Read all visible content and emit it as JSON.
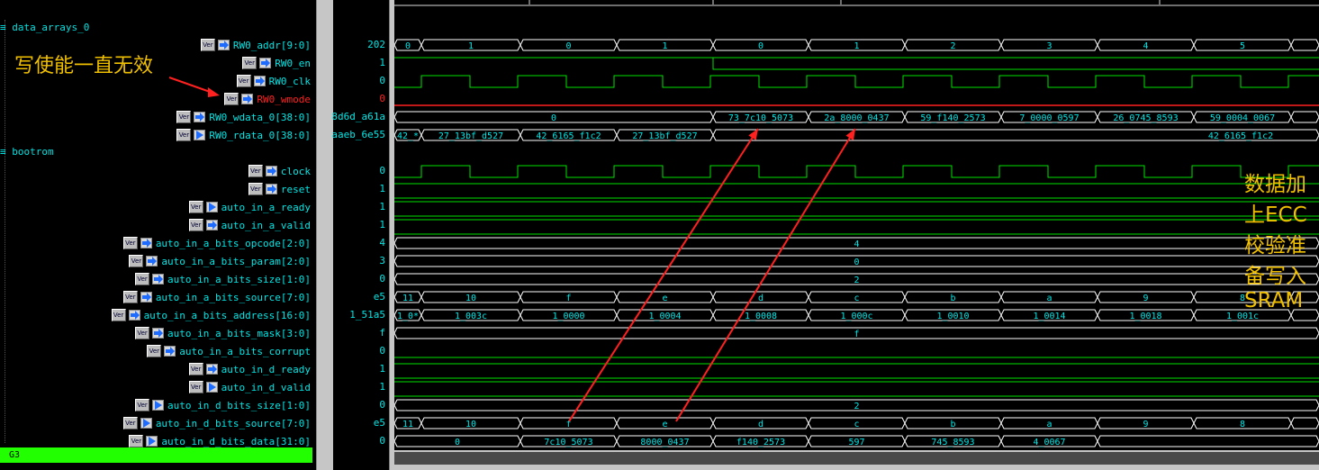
{
  "groups": [
    {
      "name": "data_arrays_0"
    },
    {
      "name": "bootrom"
    }
  ],
  "signals": [
    {
      "name": "RW0_addr[9:0]",
      "value": "202",
      "dir": "in",
      "kind": "bus",
      "cells": [
        {
          "s": 0,
          "e": 30,
          "t": "0"
        },
        {
          "s": 30,
          "e": 140,
          "t": "1"
        },
        {
          "s": 140,
          "e": 247,
          "t": "0"
        },
        {
          "s": 247,
          "e": 354,
          "t": "1"
        },
        {
          "s": 354,
          "e": 460,
          "t": "0"
        },
        {
          "s": 460,
          "e": 567,
          "t": "1"
        },
        {
          "s": 567,
          "e": 674,
          "t": "2"
        },
        {
          "s": 674,
          "e": 781,
          "t": "3"
        },
        {
          "s": 781,
          "e": 888,
          "t": "4"
        },
        {
          "s": 888,
          "e": 996,
          "t": "5"
        },
        {
          "s": 996,
          "e": 1027,
          "t": ""
        }
      ]
    },
    {
      "name": "RW0_en",
      "value": "1",
      "dir": "in",
      "kind": "en"
    },
    {
      "name": "RW0_clk",
      "value": "0",
      "dir": "in",
      "kind": "clk"
    },
    {
      "name": "RW0_wmode",
      "value": "0",
      "dir": "in",
      "kind": "low-red",
      "red": true
    },
    {
      "name": "RW0_wdata_0[38:0]",
      "value": "8d6d_a61a",
      "dir": "in",
      "kind": "bus",
      "cells": [
        {
          "s": 0,
          "e": 354,
          "t": "0"
        },
        {
          "s": 354,
          "e": 460,
          "t": "73_7c10_5073"
        },
        {
          "s": 460,
          "e": 567,
          "t": "2a_8000_0437"
        },
        {
          "s": 567,
          "e": 674,
          "t": "59_f140_2573"
        },
        {
          "s": 674,
          "e": 781,
          "t": "7_0000_0597"
        },
        {
          "s": 781,
          "e": 888,
          "t": "26_0745_8593"
        },
        {
          "s": 888,
          "e": 996,
          "t": "59_0004_0067"
        },
        {
          "s": 996,
          "e": 1027,
          "t": ""
        }
      ]
    },
    {
      "name": "RW0_rdata_0[38:0]",
      "value": "aaeb_6e55",
      "dir": "out",
      "kind": "bus",
      "cells": [
        {
          "s": 0,
          "e": 30,
          "t": "42_*"
        },
        {
          "s": 30,
          "e": 140,
          "t": "27_13bf_d527"
        },
        {
          "s": 140,
          "e": 247,
          "t": "42_6165_f1c2"
        },
        {
          "s": 247,
          "e": 354,
          "t": "27_13bf_d527"
        },
        {
          "s": 354,
          "e": 1027,
          "t": "42_6165_f1c2",
          "right": true
        }
      ]
    },
    {
      "name": "clock",
      "value": "0",
      "dir": "in",
      "kind": "clk"
    },
    {
      "name": "reset",
      "value": "1",
      "dir": "in",
      "kind": "high"
    },
    {
      "name": "auto_in_a_ready",
      "value": "1",
      "dir": "out",
      "kind": "high"
    },
    {
      "name": "auto_in_a_valid",
      "value": "1",
      "dir": "in",
      "kind": "high"
    },
    {
      "name": "auto_in_a_bits_opcode[2:0]",
      "value": "4",
      "dir": "in",
      "kind": "bus",
      "cells": [
        {
          "s": 0,
          "e": 1027,
          "t": "4"
        }
      ]
    },
    {
      "name": "auto_in_a_bits_param[2:0]",
      "value": "3",
      "dir": "in",
      "kind": "bus",
      "cells": [
        {
          "s": 0,
          "e": 1027,
          "t": "0"
        }
      ]
    },
    {
      "name": "auto_in_a_bits_size[1:0]",
      "value": "0",
      "dir": "in",
      "kind": "bus",
      "cells": [
        {
          "s": 0,
          "e": 1027,
          "t": "2"
        }
      ]
    },
    {
      "name": "auto_in_a_bits_source[7:0]",
      "value": "e5",
      "dir": "in",
      "kind": "bus",
      "cells": [
        {
          "s": 0,
          "e": 30,
          "t": "11"
        },
        {
          "s": 30,
          "e": 140,
          "t": "10"
        },
        {
          "s": 140,
          "e": 247,
          "t": "f"
        },
        {
          "s": 247,
          "e": 354,
          "t": "e"
        },
        {
          "s": 354,
          "e": 460,
          "t": "d"
        },
        {
          "s": 460,
          "e": 567,
          "t": "c"
        },
        {
          "s": 567,
          "e": 674,
          "t": "b"
        },
        {
          "s": 674,
          "e": 781,
          "t": "a"
        },
        {
          "s": 781,
          "e": 888,
          "t": "9"
        },
        {
          "s": 888,
          "e": 996,
          "t": "8"
        },
        {
          "s": 996,
          "e": 1027,
          "t": ""
        }
      ]
    },
    {
      "name": "auto_in_a_bits_address[16:0]",
      "value": "1_51a5",
      "dir": "in",
      "kind": "bus",
      "cells": [
        {
          "s": 0,
          "e": 30,
          "t": "1_0*"
        },
        {
          "s": 30,
          "e": 140,
          "t": "1_003c"
        },
        {
          "s": 140,
          "e": 247,
          "t": "1_0000"
        },
        {
          "s": 247,
          "e": 354,
          "t": "1_0004"
        },
        {
          "s": 354,
          "e": 460,
          "t": "1_0008"
        },
        {
          "s": 460,
          "e": 567,
          "t": "1_000c"
        },
        {
          "s": 567,
          "e": 674,
          "t": "1_0010"
        },
        {
          "s": 674,
          "e": 781,
          "t": "1_0014"
        },
        {
          "s": 781,
          "e": 888,
          "t": "1_0018"
        },
        {
          "s": 888,
          "e": 996,
          "t": "1_001c"
        },
        {
          "s": 996,
          "e": 1027,
          "t": ""
        }
      ]
    },
    {
      "name": "auto_in_a_bits_mask[3:0]",
      "value": "f",
      "dir": "in",
      "kind": "bus",
      "cells": [
        {
          "s": 0,
          "e": 1027,
          "t": "f"
        }
      ]
    },
    {
      "name": "auto_in_a_bits_corrupt",
      "value": "0",
      "dir": "in",
      "kind": "low"
    },
    {
      "name": "auto_in_d_ready",
      "value": "1",
      "dir": "in",
      "kind": "high"
    },
    {
      "name": "auto_in_d_valid",
      "value": "1",
      "dir": "out",
      "kind": "high"
    },
    {
      "name": "auto_in_d_bits_size[1:0]",
      "value": "0",
      "dir": "out",
      "kind": "bus",
      "cells": [
        {
          "s": 0,
          "e": 1027,
          "t": "2"
        }
      ]
    },
    {
      "name": "auto_in_d_bits_source[7:0]",
      "value": "e5",
      "dir": "out",
      "kind": "bus",
      "cells": [
        {
          "s": 0,
          "e": 30,
          "t": "11"
        },
        {
          "s": 30,
          "e": 140,
          "t": "10"
        },
        {
          "s": 140,
          "e": 247,
          "t": "f"
        },
        {
          "s": 247,
          "e": 354,
          "t": "e"
        },
        {
          "s": 354,
          "e": 460,
          "t": "d"
        },
        {
          "s": 460,
          "e": 567,
          "t": "c"
        },
        {
          "s": 567,
          "e": 674,
          "t": "b"
        },
        {
          "s": 674,
          "e": 781,
          "t": "a"
        },
        {
          "s": 781,
          "e": 888,
          "t": "9"
        },
        {
          "s": 888,
          "e": 996,
          "t": "8"
        },
        {
          "s": 996,
          "e": 1027,
          "t": ""
        }
      ]
    },
    {
      "name": "auto_in_d_bits_data[31:0]",
      "value": "0",
      "dir": "out",
      "kind": "bus",
      "cells": [
        {
          "s": 0,
          "e": 140,
          "t": "0"
        },
        {
          "s": 140,
          "e": 247,
          "t": "7c10_5073"
        },
        {
          "s": 247,
          "e": 354,
          "t": "8000_0437"
        },
        {
          "s": 354,
          "e": 460,
          "t": "f140_2573"
        },
        {
          "s": 460,
          "e": 567,
          "t": "597"
        },
        {
          "s": 567,
          "e": 674,
          "t": "745_8593"
        },
        {
          "s": 674,
          "e": 781,
          "t": "4_0067"
        },
        {
          "s": 781,
          "e": 1027,
          "t": ""
        }
      ]
    }
  ],
  "annotations": {
    "note1": "写使能一直无效",
    "note2": "数据加上ECC校验准备写入SRAM"
  },
  "status_bar": "G3",
  "colors": {
    "wave": "#00e000",
    "bus": "#ffffff",
    "text": "#00e6e6",
    "red": "#ff2020",
    "annotation": "#f0c000",
    "arrow": "#ff2020"
  }
}
